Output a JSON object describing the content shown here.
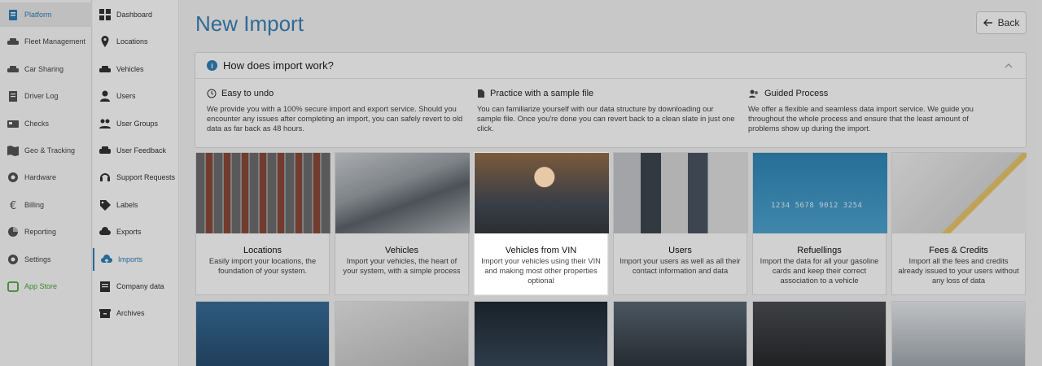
{
  "primary_nav": [
    {
      "label": "Platform",
      "icon": "clipboard-icon",
      "active": true
    },
    {
      "label": "Fleet Management",
      "icon": "car-fleet-icon"
    },
    {
      "label": "Car Sharing",
      "icon": "car-sharing-icon"
    },
    {
      "label": "Driver Log",
      "icon": "log-book-icon"
    },
    {
      "label": "Checks",
      "icon": "checks-icon"
    },
    {
      "label": "Geo & Tracking",
      "icon": "map-icon"
    },
    {
      "label": "Hardware",
      "icon": "gear-hardware-icon"
    },
    {
      "label": "Billing",
      "icon": "euro-icon"
    },
    {
      "label": "Reporting",
      "icon": "pie-chart-icon"
    },
    {
      "label": "Settings",
      "icon": "cog-icon"
    },
    {
      "label": "App Store",
      "icon": "app-store-icon",
      "green": true
    }
  ],
  "secondary_nav": [
    {
      "label": "Dashboard",
      "icon": "dashboard-icon"
    },
    {
      "label": "Locations",
      "icon": "location-pin-icon"
    },
    {
      "label": "Vehicles",
      "icon": "car-icon"
    },
    {
      "label": "Users",
      "icon": "user-icon"
    },
    {
      "label": "User Groups",
      "icon": "user-group-icon"
    },
    {
      "label": "User Feedback",
      "icon": "feedback-icon"
    },
    {
      "label": "Support Requests",
      "icon": "headset-icon"
    },
    {
      "label": "Labels",
      "icon": "tag-icon"
    },
    {
      "label": "Exports",
      "icon": "cloud-download-icon"
    },
    {
      "label": "Imports",
      "icon": "cloud-upload-icon",
      "active": true
    },
    {
      "label": "Company data",
      "icon": "company-data-icon"
    },
    {
      "label": "Archives",
      "icon": "archive-icon"
    }
  ],
  "page": {
    "title": "New Import",
    "back_label": "Back"
  },
  "how": {
    "heading": "How does import work?",
    "columns": [
      {
        "title": "Easy to undo",
        "icon": "undo-clock-icon",
        "text": "We provide you with a 100% secure import and export service. Should you encounter any issues after completing an import, you can safely revert to old data as far back as 48 hours."
      },
      {
        "title": "Practice with a sample file",
        "icon": "file-icon",
        "text": "You can familiarize yourself with our data structure by downloading our sample file. Once you're done you can revert back to a clean slate in just one click."
      },
      {
        "title": "Guided Process",
        "icon": "guide-users-icon",
        "text": "We offer a flexible and seamless data import service. We guide you throughout the whole process and ensure that the least amount of problems show up during the import."
      }
    ]
  },
  "cards": [
    {
      "title": "Locations",
      "desc": "Easily import your locations, the foundation of your system.",
      "image": "parking-lot-image"
    },
    {
      "title": "Vehicles",
      "desc": "Import your vehicles, the heart of your system, with a simple process",
      "image": "cars-row-image"
    },
    {
      "title": "Vehicles from VIN",
      "desc": "Import your vehicles using their VIN and making most other properties optional",
      "image": "driver-in-car-image",
      "highlight": true
    },
    {
      "title": "Users",
      "desc": "Import your users as well as all their contact information and data",
      "image": "meeting-people-image"
    },
    {
      "title": "Refuellings",
      "desc": "Import the data for all your gasoline cards and keep their correct association to a vehicle",
      "image": "fuel-card-image",
      "card_numbers": "1234 5678 9012 3254"
    },
    {
      "title": "Fees & Credits",
      "desc": "Import all the fees and credits already issued to your users without any loss of data",
      "image": "document-pen-image"
    }
  ],
  "row2_images": [
    "man-laptop-image",
    "signing-document-image",
    "hand-papers-image",
    "phone-in-car-image",
    "mechanic-garage-image",
    "car-handover-image"
  ]
}
